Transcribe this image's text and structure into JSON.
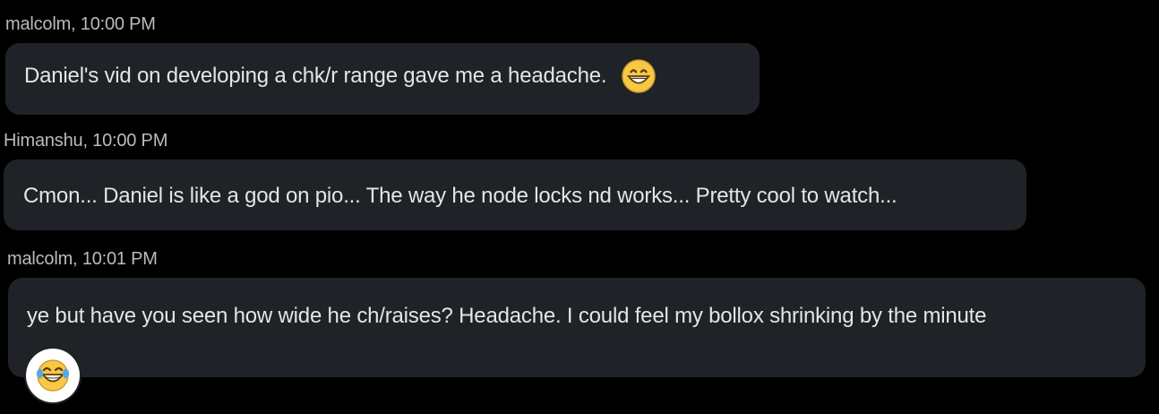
{
  "messages": [
    {
      "sender": "malcolm",
      "time": "10:00 PM",
      "meta": "malcolm, 10:00 PM",
      "text": "Daniel's vid on developing a chk/r range gave me a headache.",
      "inline_emoji": "grinning-face-icon"
    },
    {
      "sender": "Himanshu",
      "time": "10:00 PM",
      "meta": "Himanshu, 10:00 PM",
      "text": "Cmon... Daniel is like a god on pio... The way he node locks nd works... Pretty cool to watch..."
    },
    {
      "sender": "malcolm",
      "time": "10:01 PM",
      "meta": "malcolm, 10:01 PM",
      "text": "ye but have you seen how wide he ch/raises? Headache. I could feel my bollox shrinking by the minute",
      "reaction": "tears-of-joy-icon"
    }
  ],
  "colors": {
    "background": "#000000",
    "bubble": "#1f2226",
    "meta_text": "#b9bbbe",
    "message_text": "#e3e5e8",
    "emoji_yellow": "#f7c844"
  }
}
